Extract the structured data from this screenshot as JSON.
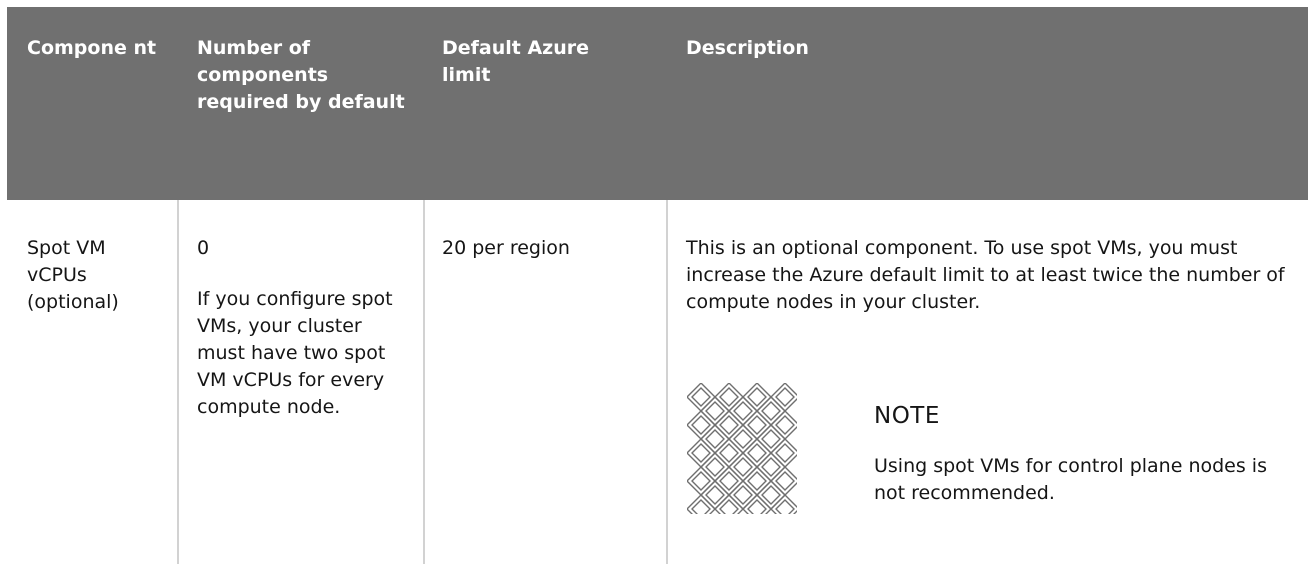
{
  "table": {
    "headers": [
      "Compone nt",
      "Number of components required by default",
      "Default Azure limit",
      "Description"
    ],
    "row": {
      "component": "Spot VM vCPUs (optional)",
      "count": "0",
      "count_note": "If you configure spot VMs, your cluster must have two spot VM vCPUs for every compute node.",
      "limit": "20 per region",
      "description": "This is an optional component. To use spot VMs, you must increase the Azure default limit to at least twice the number of compute nodes in your cluster."
    }
  },
  "note": {
    "title": "NOTE",
    "text": "Using spot VMs for control plane nodes is not recommended.",
    "icon": "note-pattern-icon"
  },
  "colors": {
    "header_bg": "#707070",
    "header_text": "#ffffff",
    "divider": "#d2d2d2",
    "body_text": "#151515"
  }
}
